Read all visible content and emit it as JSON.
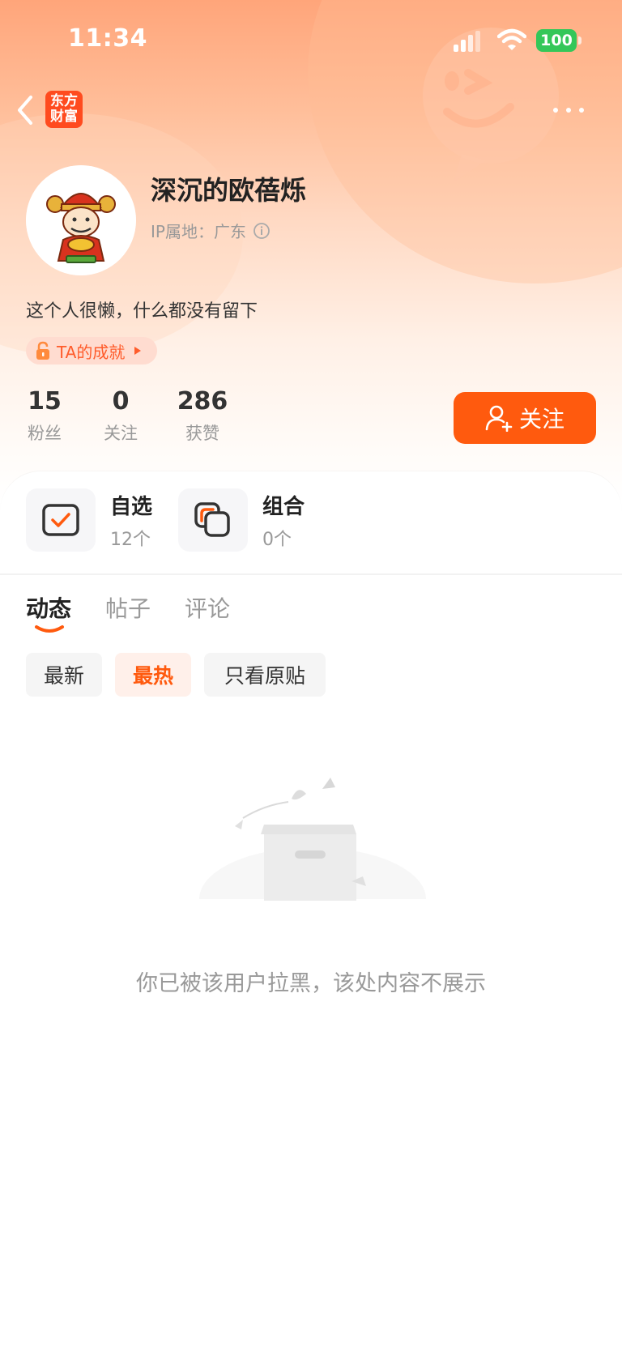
{
  "status_bar": {
    "time": "11:34",
    "battery": "100",
    "icons": [
      "signal-icon",
      "wifi-icon",
      "battery-icon"
    ]
  },
  "nav": {
    "logo_text_line1": "东方",
    "logo_text_line2": "财富",
    "icons": [
      "back-icon",
      "more-icon"
    ]
  },
  "profile": {
    "username": "深沉的欧蓓烁",
    "ip_location": "IP属地：广东",
    "bio": "这个人很懒，什么都没有留下",
    "achievement_label": "TA的成就",
    "stats": [
      {
        "value": "15",
        "label": "粉丝"
      },
      {
        "value": "0",
        "label": "关注"
      },
      {
        "value": "286",
        "label": "获赞"
      }
    ],
    "follow_label": "关注"
  },
  "quick_entries": [
    {
      "title": "自选",
      "count": "12个",
      "icon": "watchlist-check-icon"
    },
    {
      "title": "组合",
      "count": "0个",
      "icon": "portfolio-icon"
    }
  ],
  "tabs": [
    {
      "label": "动态",
      "active": true
    },
    {
      "label": "帖子",
      "active": false
    },
    {
      "label": "评论",
      "active": false
    }
  ],
  "filters": [
    {
      "label": "最新",
      "selected": false
    },
    {
      "label": "最热",
      "selected": true
    },
    {
      "label": "只看原贴",
      "selected": false
    }
  ],
  "empty_state": {
    "message": "你已被该用户拉黑，该处内容不展示",
    "icon": "empty-box-icon"
  },
  "colors": {
    "accent": "#ff5a0e",
    "accent_light": "#fff0ea",
    "header_gradient_top": "#ffa57a",
    "battery_green": "#34c759"
  }
}
